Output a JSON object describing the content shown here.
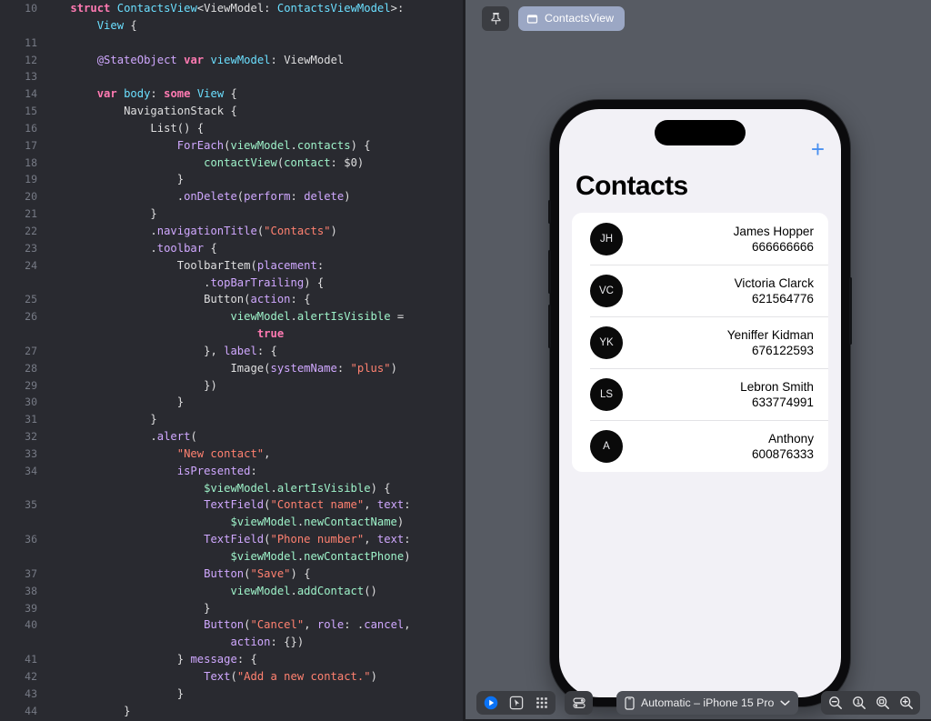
{
  "editor": {
    "language": "swift",
    "first_line_number": 10,
    "lines": [
      {
        "n": "10",
        "segs": [
          {
            "t": "    ",
            "c": "plain"
          },
          {
            "t": "struct",
            "c": "kw"
          },
          {
            "t": " ",
            "c": "plain"
          },
          {
            "t": "ContactsView",
            "c": "typ"
          },
          {
            "t": "<ViewModel: ",
            "c": "plain"
          },
          {
            "t": "ContactsViewModel",
            "c": "typ"
          },
          {
            "t": ">:",
            "c": "plain"
          },
          {
            "t": "\n        ",
            "c": "plain"
          },
          {
            "t": "View",
            "c": "typ"
          },
          {
            "t": " {",
            "c": "plain"
          }
        ]
      },
      {
        "n": "11",
        "segs": []
      },
      {
        "n": "12",
        "segs": [
          {
            "t": "        ",
            "c": "plain"
          },
          {
            "t": "@StateObject",
            "c": "attr"
          },
          {
            "t": " ",
            "c": "plain"
          },
          {
            "t": "var",
            "c": "kw"
          },
          {
            "t": " ",
            "c": "plain"
          },
          {
            "t": "viewModel",
            "c": "typ"
          },
          {
            "t": ": ",
            "c": "plain"
          },
          {
            "t": "ViewModel",
            "c": "plain"
          }
        ]
      },
      {
        "n": "13",
        "segs": []
      },
      {
        "n": "14",
        "segs": [
          {
            "t": "        ",
            "c": "plain"
          },
          {
            "t": "var",
            "c": "kw"
          },
          {
            "t": " ",
            "c": "plain"
          },
          {
            "t": "body",
            "c": "typ"
          },
          {
            "t": ": ",
            "c": "plain"
          },
          {
            "t": "some",
            "c": "kw"
          },
          {
            "t": " ",
            "c": "plain"
          },
          {
            "t": "View",
            "c": "typ"
          },
          {
            "t": " {",
            "c": "plain"
          }
        ]
      },
      {
        "n": "15",
        "segs": [
          {
            "t": "            ",
            "c": "plain"
          },
          {
            "t": "NavigationStack",
            "c": "plain"
          },
          {
            "t": " {",
            "c": "plain"
          }
        ]
      },
      {
        "n": "16",
        "segs": [
          {
            "t": "                ",
            "c": "plain"
          },
          {
            "t": "List",
            "c": "plain"
          },
          {
            "t": "() {",
            "c": "plain"
          }
        ]
      },
      {
        "n": "17",
        "segs": [
          {
            "t": "                    ",
            "c": "plain"
          },
          {
            "t": "ForEach",
            "c": "fn"
          },
          {
            "t": "(",
            "c": "plain"
          },
          {
            "t": "viewModel",
            "c": "ident"
          },
          {
            "t": ".",
            "c": "plain"
          },
          {
            "t": "contacts",
            "c": "ident"
          },
          {
            "t": ") {",
            "c": "plain"
          }
        ]
      },
      {
        "n": "18",
        "segs": [
          {
            "t": "                        ",
            "c": "plain"
          },
          {
            "t": "contactView",
            "c": "ident"
          },
          {
            "t": "(",
            "c": "plain"
          },
          {
            "t": "contact",
            "c": "ident"
          },
          {
            "t": ": ",
            "c": "plain"
          },
          {
            "t": "$0",
            "c": "plain"
          },
          {
            "t": ")",
            "c": "plain"
          }
        ]
      },
      {
        "n": "19",
        "segs": [
          {
            "t": "                    }",
            "c": "plain"
          }
        ]
      },
      {
        "n": "20",
        "segs": [
          {
            "t": "                    .",
            "c": "plain"
          },
          {
            "t": "onDelete",
            "c": "fn"
          },
          {
            "t": "(",
            "c": "plain"
          },
          {
            "t": "perform",
            "c": "fn"
          },
          {
            "t": ": ",
            "c": "plain"
          },
          {
            "t": "delete",
            "c": "fn"
          },
          {
            "t": ")",
            "c": "plain"
          }
        ]
      },
      {
        "n": "21",
        "segs": [
          {
            "t": "                }",
            "c": "plain"
          }
        ]
      },
      {
        "n": "22",
        "segs": [
          {
            "t": "                .",
            "c": "plain"
          },
          {
            "t": "navigationTitle",
            "c": "fn"
          },
          {
            "t": "(",
            "c": "plain"
          },
          {
            "t": "\"Contacts\"",
            "c": "str"
          },
          {
            "t": ")",
            "c": "plain"
          }
        ]
      },
      {
        "n": "23",
        "segs": [
          {
            "t": "                .",
            "c": "plain"
          },
          {
            "t": "toolbar",
            "c": "fn"
          },
          {
            "t": " {",
            "c": "plain"
          }
        ]
      },
      {
        "n": "24",
        "segs": [
          {
            "t": "                    ",
            "c": "plain"
          },
          {
            "t": "ToolbarItem",
            "c": "plain"
          },
          {
            "t": "(",
            "c": "plain"
          },
          {
            "t": "placement",
            "c": "fn"
          },
          {
            "t": ":",
            "c": "plain"
          },
          {
            "t": "\n                        .",
            "c": "plain"
          },
          {
            "t": "topBarTrailing",
            "c": "fn"
          },
          {
            "t": ") {",
            "c": "plain"
          }
        ]
      },
      {
        "n": "25",
        "segs": [
          {
            "t": "                        ",
            "c": "plain"
          },
          {
            "t": "Button",
            "c": "plain"
          },
          {
            "t": "(",
            "c": "plain"
          },
          {
            "t": "action",
            "c": "fn"
          },
          {
            "t": ": {",
            "c": "plain"
          }
        ]
      },
      {
        "n": "26",
        "segs": [
          {
            "t": "                            ",
            "c": "plain"
          },
          {
            "t": "viewModel",
            "c": "ident"
          },
          {
            "t": ".",
            "c": "plain"
          },
          {
            "t": "alertIsVisible",
            "c": "ident"
          },
          {
            "t": " =",
            "c": "plain"
          },
          {
            "t": "\n                                ",
            "c": "plain"
          },
          {
            "t": "true",
            "c": "kw"
          }
        ]
      },
      {
        "n": "27",
        "segs": [
          {
            "t": "                        }, ",
            "c": "plain"
          },
          {
            "t": "label",
            "c": "fn"
          },
          {
            "t": ": {",
            "c": "plain"
          }
        ]
      },
      {
        "n": "28",
        "segs": [
          {
            "t": "                            ",
            "c": "plain"
          },
          {
            "t": "Image",
            "c": "plain"
          },
          {
            "t": "(",
            "c": "plain"
          },
          {
            "t": "systemName",
            "c": "fn"
          },
          {
            "t": ": ",
            "c": "plain"
          },
          {
            "t": "\"plus\"",
            "c": "str"
          },
          {
            "t": ")",
            "c": "plain"
          }
        ]
      },
      {
        "n": "29",
        "segs": [
          {
            "t": "                        })",
            "c": "plain"
          }
        ]
      },
      {
        "n": "30",
        "segs": [
          {
            "t": "                    }",
            "c": "plain"
          }
        ]
      },
      {
        "n": "31",
        "segs": [
          {
            "t": "                }",
            "c": "plain"
          }
        ]
      },
      {
        "n": "32",
        "segs": [
          {
            "t": "                .",
            "c": "plain"
          },
          {
            "t": "alert",
            "c": "fn"
          },
          {
            "t": "(",
            "c": "plain"
          }
        ]
      },
      {
        "n": "33",
        "segs": [
          {
            "t": "                    ",
            "c": "plain"
          },
          {
            "t": "\"New contact\"",
            "c": "str"
          },
          {
            "t": ",",
            "c": "plain"
          }
        ]
      },
      {
        "n": "34",
        "segs": [
          {
            "t": "                    ",
            "c": "plain"
          },
          {
            "t": "isPresented",
            "c": "fn"
          },
          {
            "t": ":",
            "c": "plain"
          },
          {
            "t": "\n                        ",
            "c": "plain"
          },
          {
            "t": "$viewModel",
            "c": "ident"
          },
          {
            "t": ".",
            "c": "plain"
          },
          {
            "t": "alertIsVisible",
            "c": "ident"
          },
          {
            "t": ") {",
            "c": "plain"
          }
        ]
      },
      {
        "n": "35",
        "segs": [
          {
            "t": "                        ",
            "c": "plain"
          },
          {
            "t": "TextField",
            "c": "fn"
          },
          {
            "t": "(",
            "c": "plain"
          },
          {
            "t": "\"Contact name\"",
            "c": "str"
          },
          {
            "t": ", ",
            "c": "plain"
          },
          {
            "t": "text",
            "c": "fn"
          },
          {
            "t": ":",
            "c": "plain"
          },
          {
            "t": "\n                            ",
            "c": "plain"
          },
          {
            "t": "$viewModel",
            "c": "ident"
          },
          {
            "t": ".",
            "c": "plain"
          },
          {
            "t": "newContactName",
            "c": "ident"
          },
          {
            "t": ")",
            "c": "plain"
          }
        ]
      },
      {
        "n": "36",
        "segs": [
          {
            "t": "                        ",
            "c": "plain"
          },
          {
            "t": "TextField",
            "c": "fn"
          },
          {
            "t": "(",
            "c": "plain"
          },
          {
            "t": "\"Phone number\"",
            "c": "str"
          },
          {
            "t": ", ",
            "c": "plain"
          },
          {
            "t": "text",
            "c": "fn"
          },
          {
            "t": ":",
            "c": "plain"
          },
          {
            "t": "\n                            ",
            "c": "plain"
          },
          {
            "t": "$viewModel",
            "c": "ident"
          },
          {
            "t": ".",
            "c": "plain"
          },
          {
            "t": "newContactPhone",
            "c": "ident"
          },
          {
            "t": ")",
            "c": "plain"
          }
        ]
      },
      {
        "n": "37",
        "segs": [
          {
            "t": "                        ",
            "c": "plain"
          },
          {
            "t": "Button",
            "c": "fn"
          },
          {
            "t": "(",
            "c": "plain"
          },
          {
            "t": "\"Save\"",
            "c": "str"
          },
          {
            "t": ") {",
            "c": "plain"
          }
        ]
      },
      {
        "n": "38",
        "segs": [
          {
            "t": "                            ",
            "c": "plain"
          },
          {
            "t": "viewModel",
            "c": "ident"
          },
          {
            "t": ".",
            "c": "plain"
          },
          {
            "t": "addContact",
            "c": "ident"
          },
          {
            "t": "()",
            "c": "plain"
          }
        ]
      },
      {
        "n": "39",
        "segs": [
          {
            "t": "                        }",
            "c": "plain"
          }
        ]
      },
      {
        "n": "40",
        "segs": [
          {
            "t": "                        ",
            "c": "plain"
          },
          {
            "t": "Button",
            "c": "fn"
          },
          {
            "t": "(",
            "c": "plain"
          },
          {
            "t": "\"Cancel\"",
            "c": "str"
          },
          {
            "t": ", ",
            "c": "plain"
          },
          {
            "t": "role",
            "c": "fn"
          },
          {
            "t": ": .",
            "c": "plain"
          },
          {
            "t": "cancel",
            "c": "fn"
          },
          {
            "t": ",",
            "c": "plain"
          },
          {
            "t": "\n                            ",
            "c": "plain"
          },
          {
            "t": "action",
            "c": "fn"
          },
          {
            "t": ": {})",
            "c": "plain"
          }
        ]
      },
      {
        "n": "41",
        "segs": [
          {
            "t": "                    } ",
            "c": "plain"
          },
          {
            "t": "message",
            "c": "fn"
          },
          {
            "t": ": {",
            "c": "plain"
          }
        ]
      },
      {
        "n": "42",
        "segs": [
          {
            "t": "                        ",
            "c": "plain"
          },
          {
            "t": "Text",
            "c": "fn"
          },
          {
            "t": "(",
            "c": "plain"
          },
          {
            "t": "\"Add a new contact.\"",
            "c": "str"
          },
          {
            "t": ")",
            "c": "plain"
          }
        ]
      },
      {
        "n": "43",
        "segs": [
          {
            "t": "                    }",
            "c": "plain"
          }
        ]
      },
      {
        "n": "44",
        "segs": [
          {
            "t": "            }",
            "c": "plain"
          }
        ]
      }
    ]
  },
  "preview": {
    "pin_icon": "pin-icon",
    "breadcrumb": {
      "icon": "struct-icon",
      "label": "ContactsView"
    },
    "device": {
      "name": "iPhone 15 Pro",
      "chip_label": "Automatic – iPhone 15 Pro",
      "icon": "iphone-icon",
      "chevron": "chevron-down-icon"
    },
    "toolbar": {
      "play_icon": "play-icon",
      "inspect_icon": "select-pointer-icon",
      "variants_icon": "grid-dots-icon",
      "device_settings_icon": "toggles-icon",
      "zoom_out_icon": "zoom-out-icon",
      "zoom_actual_icon": "zoom-actual-size-icon",
      "zoom_fit_icon": "zoom-to-fit-icon",
      "zoom_in_icon": "zoom-in-icon"
    },
    "app": {
      "title": "Contacts",
      "add_button_label": "+",
      "contacts": [
        {
          "initials": "JH",
          "name": "James Hopper",
          "phone": "666666666"
        },
        {
          "initials": "VC",
          "name": "Victoria Clarck",
          "phone": "621564776"
        },
        {
          "initials": "YK",
          "name": "Yeniffer Kidman",
          "phone": "676122593"
        },
        {
          "initials": "LS",
          "name": "Lebron Smith",
          "phone": "633774991"
        },
        {
          "initials": "A",
          "name": "Anthony",
          "phone": "600876333"
        }
      ]
    }
  },
  "colors": {
    "editor_bg": "#292A30",
    "canvas_bg": "#575B63",
    "accent_blue": "#4A90F0",
    "crumb_bg": "#9BA7C4",
    "keyword": "#FF7AB2",
    "type": "#6BDFFF",
    "function": "#D0A8FF",
    "identifier": "#9EF2C9",
    "string": "#FF8170"
  }
}
